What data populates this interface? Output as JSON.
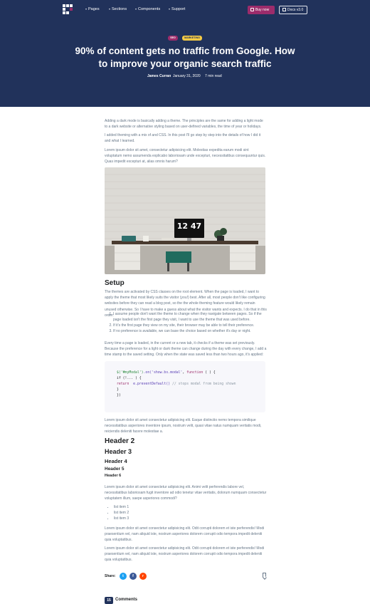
{
  "nav": {
    "items": [
      "Pages",
      "Sections",
      "Components",
      "Support"
    ],
    "buy_label": "Buy now",
    "docs_label": "Docs v3.0"
  },
  "hero": {
    "tags": [
      "SEO",
      "MARKETING"
    ],
    "title": "90% of content gets no traffic from Google. How to improve your organic search traffic",
    "author": "James Curran",
    "date": "January 31, 2020",
    "read_time": "7 min read"
  },
  "article": {
    "intro_1": "Adding a dark mode is basically adding a theme. The principles are the same for adding a light mode to a dark website or alternative styling based on user-defined variables, the time of year or holidays.",
    "intro_2": "I added theming with a mix of and CSS. In this post I'll go step by step into the details of how I did it and what I learned.",
    "intro_3": "Lorem ipsum dolor sit amet, consectetur adipisicing elit. Molestias expedita earum modi sint voluptatum nemo assumenda explicabo laboriosam unde excepturi, necessitatibus consequuntur quis. Quas impedit excepturi at, alias omnis harum?",
    "photo_clock": "12 47",
    "setup_heading": "Setup",
    "setup_p": "The themes are activated by CSS classes on the root element. When the page is loaded, I want to apply the theme that most likely suits the visitor (you!) best. After all, most people don't like configuring websites before they can read a blog post, so the the whole theming feature would likely remain unused otherwise. So I have to make a guess about what the visitor wants and expects. I do that in this order:",
    "ordered": [
      "I assume people don't want the theme to change when they navigate between pages. So if the page loaded isn't the first page they visit, I want to use the theme that was used before.",
      "If it's the first page they view on my site, their browser may be able to tell their preference.",
      "If no preference is available, we can base the choice based on whether it's day or night."
    ],
    "every_time_p": "Every time a page is loaded, in the current or a new tab, it checks if a theme was set previously. Because the preference for a light or dark theme can change during the day with every change, I add a time stamp to the saved setting. Only when the state was saved less than two hours ago, it's applied:",
    "code": {
      "line1_str": "$('#myModal')",
      "line1_fn": ".on('show.bs.modal'",
      "line1_kw": "function",
      "line1_end": " ( ) {",
      "line2": "if (!... ) {",
      "line3_kw": "return",
      "line3_fn": "e.preventDefault()",
      "line3_cm": "// stops modal from being shown",
      "line4": "}",
      "line5": "})"
    },
    "lorem_p": "Lorem ipsum dolor sit amet consectetur adipisicing elit. Eaque distinctio nemo tempora similique necessitatibus asperiores inventore ipsum, nostrum velit, quasi vitae natus numquam veritatis modi, reiciendis deleniti facere molestiae a.",
    "headers": [
      "Header 2",
      "Header 3",
      "Header 4",
      "Header 5",
      "Header 6"
    ],
    "lorem_p2": "Lorem ipsum dolor sit amet consectetur adipisicing elit. Animi velit perferendis labore vel, necessitatibus laboriosam fugit inventore ad odio tenetur vitae veritatis, dolorum numquam consectetur voluptatem illum, saepe asperiores commodi?",
    "bullets": [
      "list item 1",
      "list item 2",
      "list item 3"
    ],
    "lorem_p3": "Lorem ipsum dolor sit amet consectetur adipisicing elit. Odit corrupti dolorem et iste perferendis! Modi praesentium vel, nam aliquid iste, nostrum asperiores dolorem corrupti odio tempora impedit deleniti quia voluptatibus.",
    "lorem_p4": "Lorem ipsum dolor sit amet consectetur adipisicing elit. Odit corrupti dolorem et iste perferendis! Modi praesentium vel, nam aliquid iste, nostrum asperiores dolorem corrupti odio tempora impedit deleniti quia voluptatibus."
  },
  "share": {
    "label": "Share:",
    "networks": [
      "twitter-icon",
      "facebook-icon",
      "reddit-icon"
    ],
    "colors": {
      "twitter": "#1da1f2",
      "facebook": "#3b5998",
      "reddit": "#ff4500"
    }
  },
  "comments": {
    "count": "15",
    "title": "Comments"
  },
  "colors": {
    "hero_bg": "#21325b",
    "accent": "#9c2c6b",
    "tag_marketing": "#f5ca44"
  }
}
